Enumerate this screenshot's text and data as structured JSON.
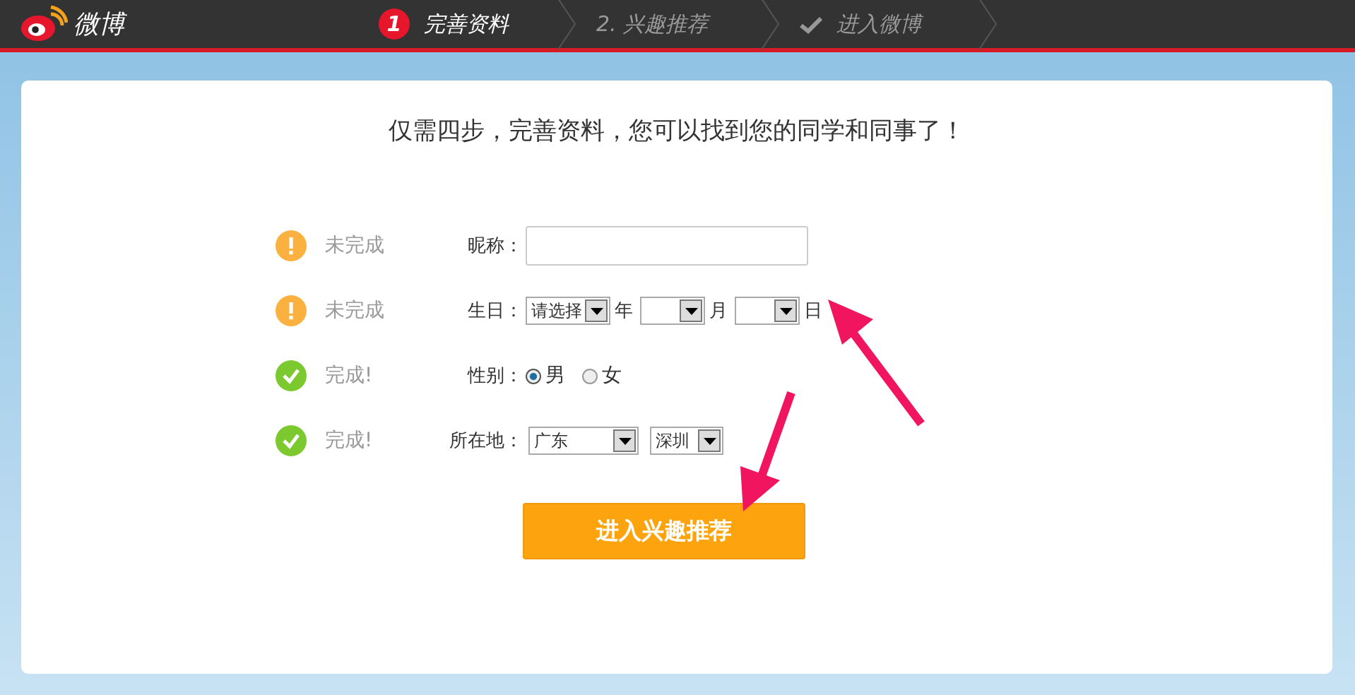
{
  "header": {
    "logo_text": "微博",
    "steps": [
      {
        "kind": "number",
        "number": "1",
        "label": "完善资料",
        "selected": true
      },
      {
        "kind": "plain",
        "label": "2.  兴趣推荐",
        "selected": false
      },
      {
        "kind": "check",
        "label": "进入微博",
        "selected": false
      }
    ]
  },
  "form": {
    "title": "仅需四步，完善资料，您可以找到您的同学和同事了！",
    "rows": [
      {
        "kind": "text",
        "done": false,
        "status": "未完成",
        "label": "昵称："
      },
      {
        "kind": "birthday",
        "done": false,
        "status": "未完成",
        "label": "生日：",
        "selects": [
          {
            "value": "请选择",
            "unit": "年"
          },
          {
            "unit": "月"
          },
          {
            "unit": "日"
          }
        ]
      },
      {
        "kind": "gender",
        "done": true,
        "status": "完成!",
        "label": "性别：",
        "options": [
          {
            "label": "男",
            "selected": true
          },
          {
            "label": "女",
            "selected": false
          }
        ]
      },
      {
        "kind": "location",
        "done": true,
        "status": "完成!",
        "label": "所在地：",
        "selects": [
          {
            "value": "广东"
          },
          {
            "value": "深圳"
          }
        ]
      }
    ],
    "submit": "进入兴趣推荐"
  }
}
